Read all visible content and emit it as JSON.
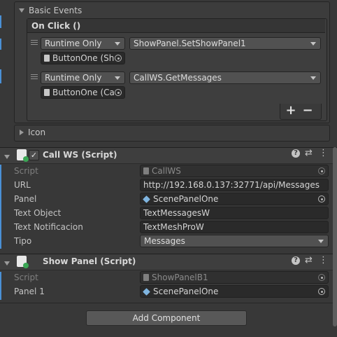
{
  "basic_events": {
    "title": "Basic Events",
    "onclick_header": "On Click ()",
    "listeners": [
      {
        "runtime": "Runtime Only",
        "function": "ShowPanel.SetShowPanel1",
        "target": "ButtonOne (Sh"
      },
      {
        "runtime": "Runtime Only",
        "function": "CallWS.GetMessages",
        "target": "ButtonOne (Ca"
      }
    ],
    "add_label": "+",
    "remove_label": "−"
  },
  "icon_foldout": {
    "title": "Icon"
  },
  "call_ws": {
    "title": "Call WS (Script)",
    "script_label": "Script",
    "script_value": "CallWS",
    "url_label": "URL",
    "url_value": "http://192.168.0.137:32771/api/Messages",
    "panel_label": "Panel",
    "panel_value": "ScenePanelOne",
    "text_object_label": "Text Object",
    "text_object_value": "TextMessagesW",
    "text_notif_label": "Text Notificacion",
    "text_notif_value": "TextMeshProW",
    "tipo_label": "Tipo",
    "tipo_value": "Messages"
  },
  "show_panel": {
    "title": "Show Panel (Script)",
    "script_label": "Script",
    "script_value": "ShowPanelB1",
    "panel1_label": "Panel 1",
    "panel1_value": "ScenePanelOne"
  },
  "add_component": "Add Component",
  "header_icons": {
    "help": "?",
    "settings": "⇄",
    "menu": "⋮"
  },
  "colors": {
    "accent": "#4a90d6",
    "background": "#383838"
  }
}
